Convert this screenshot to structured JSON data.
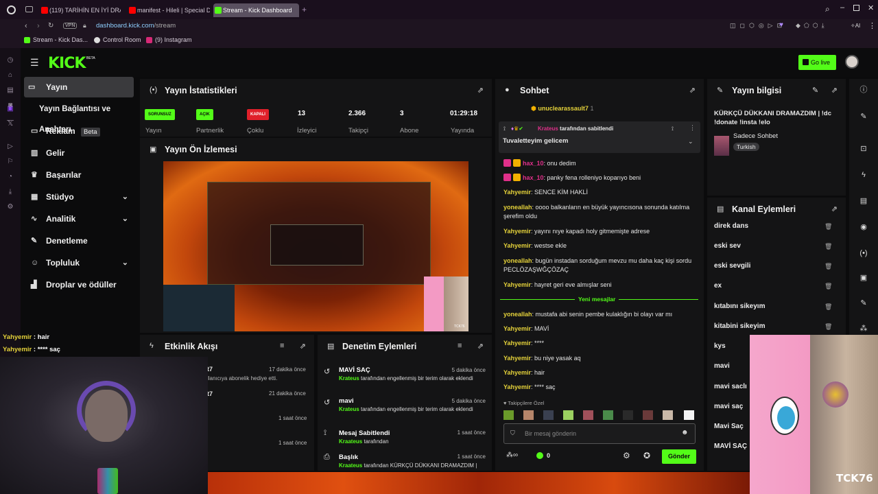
{
  "browser": {
    "tabs": [
      {
        "label": "(119) TARİHİN EN İYİ DRAM",
        "color": "#ff0000"
      },
      {
        "label": "manifest - Hileli | Special D",
        "color": "#ff0000"
      },
      {
        "label": "Stream - Kick Dashboard",
        "color": "#53fc18"
      }
    ],
    "url_host": "dashboard.kick.com",
    "url_path": "/stream",
    "vpn": "VPN",
    "bookmarks": [
      {
        "label": "Stream - Kick Das...",
        "color": "#53fc18"
      },
      {
        "label": "Control Room",
        "color": "#dddddd"
      },
      {
        "label": "(9) Instagram",
        "color": "#d62976"
      }
    ]
  },
  "header": {
    "logo": "KICK",
    "beta": "BETA",
    "go_live": "Go live"
  },
  "sidebar": {
    "items": [
      {
        "label": "Yayın",
        "icon": "broadcast-icon"
      },
      {
        "label": "Yayın Bağlantısı ve Anahtarı"
      },
      {
        "label": "Reklam",
        "badge": "Beta",
        "icon": "tv-icon"
      },
      {
        "label": "Gelir",
        "icon": "chart-icon"
      },
      {
        "label": "Başarılar",
        "icon": "trophy-icon"
      },
      {
        "label": "Stüdyo",
        "icon": "grid-icon"
      },
      {
        "label": "Analitik",
        "icon": "analytics-icon"
      },
      {
        "label": "Denetleme",
        "icon": "wrench-icon"
      },
      {
        "label": "Topluluk",
        "icon": "users-icon"
      },
      {
        "label": "Droplar ve ödüller",
        "icon": "gift-icon"
      }
    ]
  },
  "stats": {
    "title": "Yayın İstatistikleri",
    "items": [
      {
        "badge": "SORUNSUZ",
        "label": "Yayın"
      },
      {
        "badge": "AÇIK",
        "label": "Partnerlik"
      },
      {
        "badge": "KAPALI",
        "label": "Çoklu"
      },
      {
        "value": "13",
        "label": "İzleyici"
      },
      {
        "value": "2.366",
        "label": "Takipçi"
      },
      {
        "value": "3",
        "label": "Abone"
      },
      {
        "value": "01:29:18",
        "label": "Yayında"
      }
    ]
  },
  "preview": {
    "title": "Yayın Ön İzlemesi",
    "cam_label": "TCK76"
  },
  "activity": {
    "title": "Etkinlik Akışı",
    "rows": [
      {
        "text": "t7",
        "sub": "llanıcıya abonelik hediye etti.",
        "time": "17 dakika önce"
      },
      {
        "text": "t7",
        "sub": "",
        "time": "21 dakika önce"
      },
      {
        "text": "",
        "sub": "",
        "time": "1 saat önce"
      },
      {
        "text": "",
        "sub": "",
        "time": "1 saat önce"
      }
    ]
  },
  "moderation": {
    "title": "Denetim Eylemleri",
    "rows": [
      {
        "title": "MAVİ SAÇ",
        "time": "5 dakika önce",
        "user": "Krateus",
        "desc": "tarafından engellenmiş bir terim olarak eklendi"
      },
      {
        "title": "mavi",
        "time": "5 dakika önce",
        "user": "Krateus",
        "desc": "tarafından engellenmiş bir terim olarak eklendi"
      },
      {
        "title": "Mesaj Sabitlendi",
        "time": "1 saat önce",
        "user": "Kraateus",
        "desc": "tarafından"
      },
      {
        "title": "Başlık",
        "time": "1 saat önce",
        "user": "Kraateus",
        "desc": "tarafından KÜRKÇÜ DÜKKANI DRAMAZDIM |"
      }
    ]
  },
  "chat": {
    "title": "Sohbet",
    "top_user": "unuclearassault7",
    "top_count": "1",
    "pinned_by_user": "Krateus",
    "pinned_label": "tarafından sabitlendi",
    "pinned_text": "Tuvaletteyim gelicem",
    "messages": [
      {
        "user": "hax_10",
        "text": ": onu dedim",
        "color": "pink",
        "badge": true
      },
      {
        "user": "hax_10",
        "text": ": panky fena rolleniyo koparıyo beni",
        "color": "pink",
        "badge": true
      },
      {
        "user": "Yahyemir",
        "text": ": SENCE KİM HAKLİ",
        "color": "yel"
      },
      {
        "user": "yoneallah",
        "text": ": oooo balkanların en büyük yayıncısona sonunda katılma şerefim oldu",
        "color": "yel"
      },
      {
        "user": "Yahyemir",
        "text": ": yayını nıye kapadı holy gitmemişte adrese",
        "color": "yel"
      },
      {
        "user": "Yahyemir",
        "text": ": westse ekle",
        "color": "yel"
      },
      {
        "user": "yoneallah",
        "text": ": bugün instadan sorduğum mevzu mu daha kaç kişi sordu PECLÖZAŞWĞÇÖZAÇ",
        "color": "yel"
      },
      {
        "user": "Yahyemir",
        "text": ": hayret geri eve almışlar seni",
        "color": "yel"
      }
    ],
    "new_messages": "Yeni mesajlar",
    "messages2": [
      {
        "user": "yoneallah",
        "text": ": mustafa abi senin pembe kulaklığın bi olayı var mı"
      },
      {
        "user": "Yahyemir",
        "text": ": MAVİ"
      },
      {
        "user": "Yahyemir",
        "text": ": ****"
      },
      {
        "user": "Yahyemir",
        "text": ": bu niye yasak aq"
      },
      {
        "user": "Yahyemir",
        "text": ": hair"
      },
      {
        "user": "Yahyemir",
        "text": ": **** saç"
      }
    ],
    "emote_label": "Takipçilere Özel",
    "input_placeholder": "Bir mesaj gönderin",
    "points": "0",
    "send": "Gönder"
  },
  "info": {
    "title": "Yayın bilgisi",
    "stream_title": "KÜRKÇÜ DÜKKANI DRAMAZDIM | !dc !donate !insta !elo",
    "category": "Sadece Sohbet",
    "language": "Turkish"
  },
  "channel_actions": {
    "title": "Kanal Eylemleri",
    "items": [
      "direk dans",
      "eski sev",
      "eski sevgili",
      "ex",
      "kıtabını sikeyım",
      "kitabini sikeyim",
      "kys",
      "mavi",
      "mavi saclı",
      "mavi saç",
      "Mavi Saç",
      "MAVİ SAÇ"
    ]
  },
  "overlay": {
    "lines": [
      {
        "user": "Yahyemir",
        "text": " : hair"
      },
      {
        "user": "Yahyemir",
        "text": " : **** saç"
      }
    ],
    "tag": "TCK76"
  },
  "colors": {
    "kick_green": "#53fc18",
    "panel": "#141415",
    "bg": "#0b0b0c"
  }
}
